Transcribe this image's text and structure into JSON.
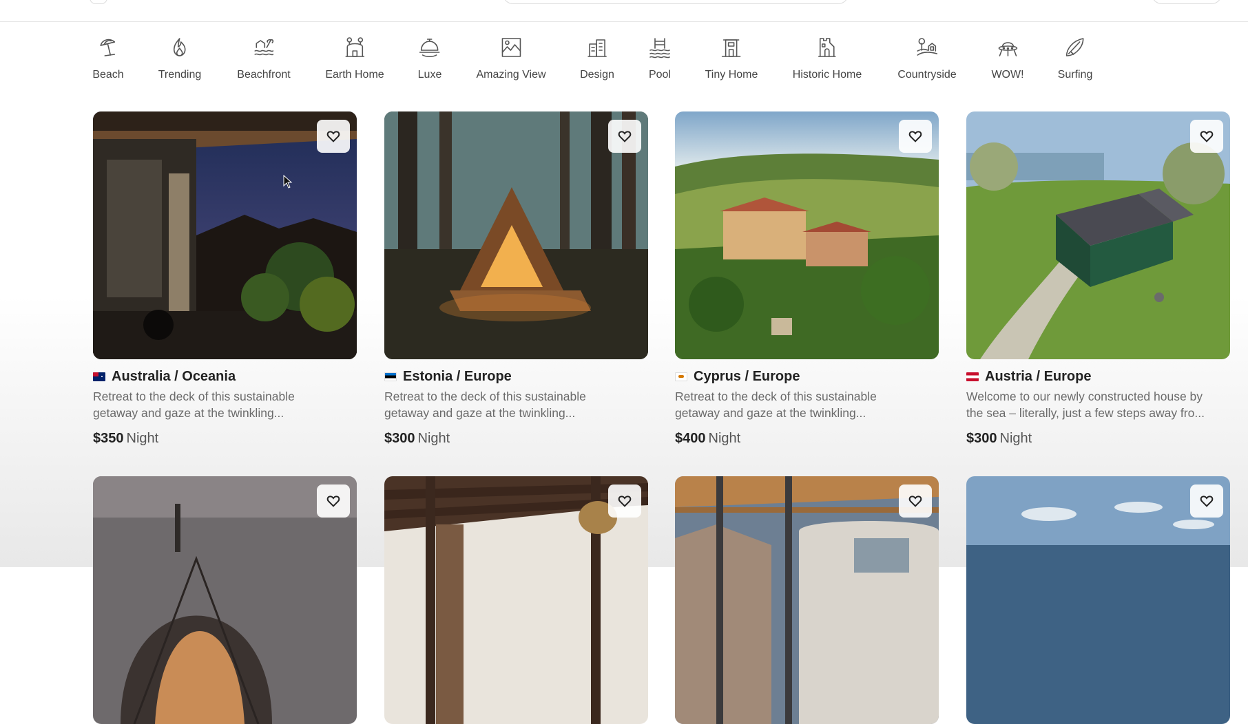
{
  "categories": [
    {
      "label": "Beach",
      "icon": "beach-umbrella-icon"
    },
    {
      "label": "Trending",
      "icon": "flame-icon"
    },
    {
      "label": "Beachfront",
      "icon": "beachfront-icon"
    },
    {
      "label": "Earth Home",
      "icon": "earth-home-icon"
    },
    {
      "label": "Luxe",
      "icon": "luxe-bell-icon"
    },
    {
      "label": "Amazing View",
      "icon": "amazing-view-icon"
    },
    {
      "label": "Design",
      "icon": "design-building-icon"
    },
    {
      "label": "Pool",
      "icon": "pool-icon"
    },
    {
      "label": "Tiny Home",
      "icon": "tiny-home-icon"
    },
    {
      "label": "Historic Home",
      "icon": "historic-home-icon"
    },
    {
      "label": "Countryside",
      "icon": "countryside-icon"
    },
    {
      "label": "WOW!",
      "icon": "wow-ufo-icon"
    },
    {
      "label": "Surfing",
      "icon": "surfboard-icon"
    }
  ],
  "listings": [
    {
      "location": "Australia / Oceania",
      "flag": "australia-flag",
      "desc_line1": "Retreat to the deck of this sustainable",
      "desc_line2": "getaway and gaze at the twinkling...",
      "price": "$350",
      "per": "Night",
      "photo": "night-terrace-photo"
    },
    {
      "location": "Estonia / Europe",
      "flag": "estonia-flag",
      "desc_line1": "Retreat to the deck of this sustainable",
      "desc_line2": "getaway and gaze at the twinkling...",
      "price": "$300",
      "per": "Night",
      "photo": "forest-a-frame-cabin-photo"
    },
    {
      "location": "Cyprus / Europe",
      "flag": "cyprus-flag",
      "desc_line1": "Retreat to the deck of this sustainable",
      "desc_line2": "getaway and gaze at the twinkling...",
      "price": "$400",
      "per": "Night",
      "photo": "vineyard-villa-photo"
    },
    {
      "location": "Austria / Europe",
      "flag": "austria-flag",
      "desc_line1": "Welcome to our newly constructed house by",
      "desc_line2": "the sea – literally, just a few steps away fro...",
      "price": "$300",
      "per": "Night",
      "photo": "green-cottage-photo"
    },
    {
      "photo": "glass-dome-photo"
    },
    {
      "photo": "wooden-beam-interior-photo"
    },
    {
      "photo": "camper-van-canopy-photo"
    },
    {
      "photo": "sea-horizon-photo"
    }
  ],
  "colors": {
    "heart_bg": "#ffffff",
    "text": "#222222",
    "muted": "#6b6b6b",
    "price_unit": "#555555"
  }
}
